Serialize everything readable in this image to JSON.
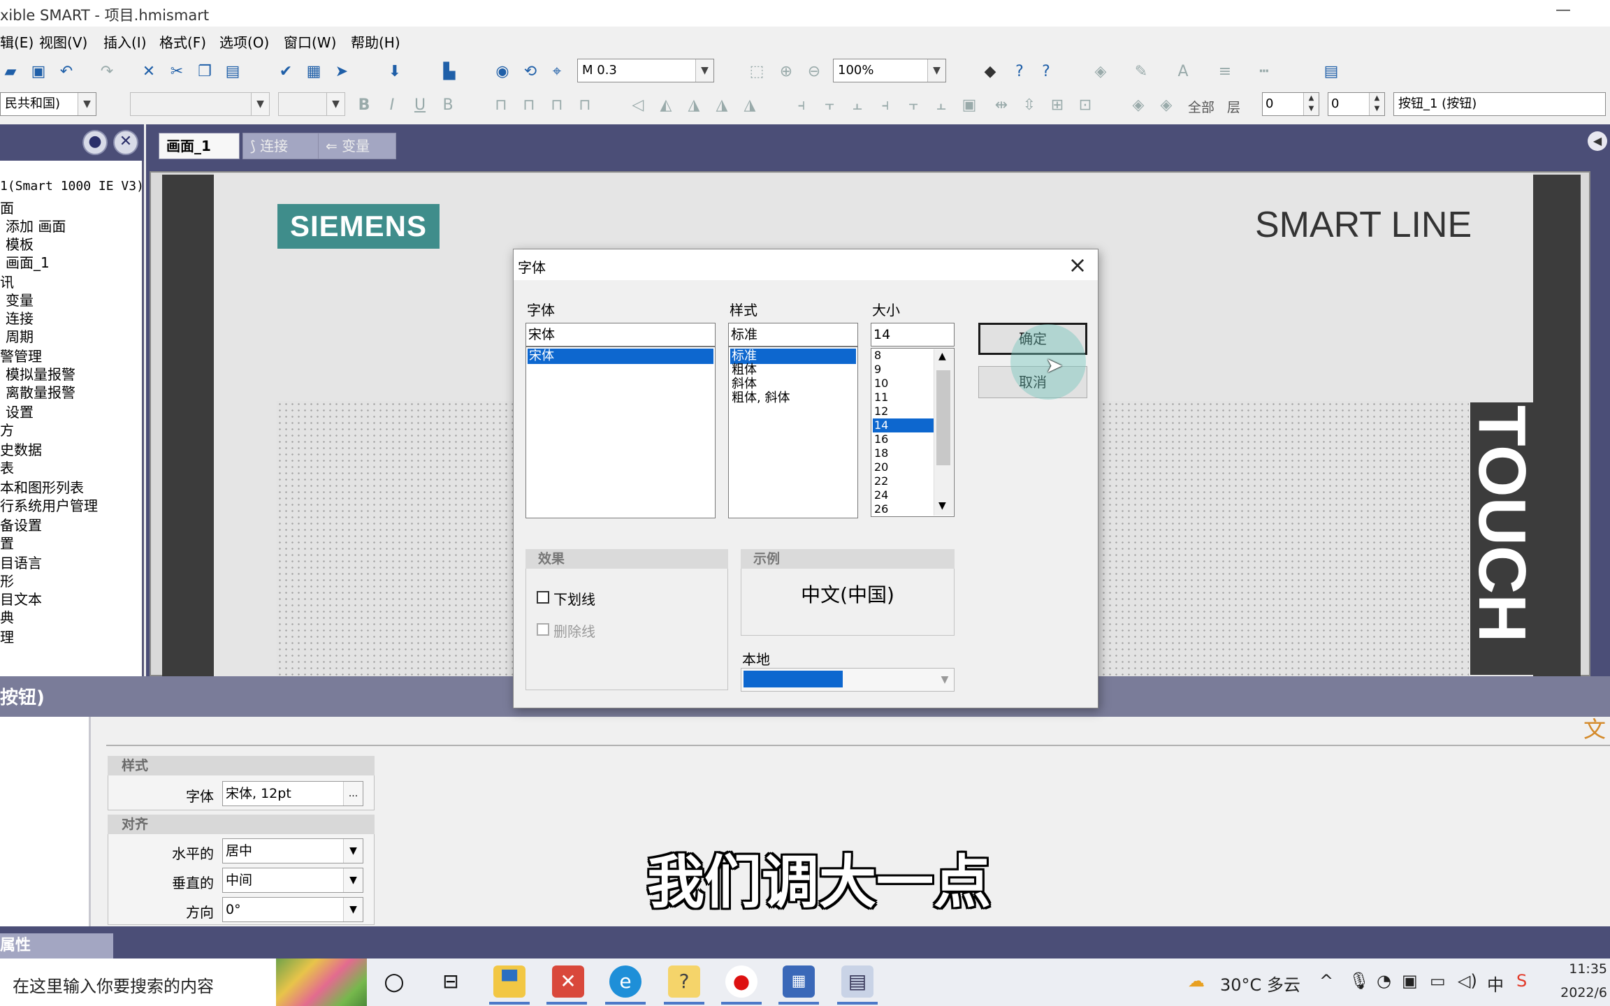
{
  "window": {
    "title": "xible SMART - 项目.hmismart",
    "minimize_glyph": "—"
  },
  "menu": [
    "辑(E)",
    "视图(V)",
    "插入(I)",
    "格式(F)",
    "选项(O)",
    "窗口(W)",
    "帮助(H)"
  ],
  "toolbar1": {
    "address_value": "M 0.3",
    "zoom_value": "100%"
  },
  "toolbar2": {
    "language_value": "民共和国)",
    "all_label": "全部",
    "layer_label": "层",
    "x_value": "0",
    "y_value": "0",
    "object_value": "按钮_1 (按钮)"
  },
  "tree": {
    "items": [
      "1(Smart 1000 IE V3)",
      "面",
      "添加 画面",
      "模板",
      "画面_1",
      "讯",
      "变量",
      "连接",
      "周期",
      "警管理",
      "模拟量报警",
      "离散量报警",
      "设置",
      "方",
      "史数据",
      "表",
      "本和图形列表",
      "行系统用户管理",
      "备设置",
      "置",
      "目语言",
      "形",
      "目文本",
      "典",
      "理"
    ]
  },
  "tabs": [
    {
      "label": "画面_1",
      "active": true
    },
    {
      "label": "连接",
      "active": false
    },
    {
      "label": "变量",
      "active": false
    }
  ],
  "hmi": {
    "logo": "SIEMENS",
    "brand_line": "SMART LINE",
    "side_text": "TOUCH"
  },
  "properties": {
    "header": "按钮)",
    "bottom_tab": "属性",
    "style_group": "样式",
    "font_label": "字体",
    "font_value": "宋体, 12pt",
    "font_btn": "...",
    "align_group": "对齐",
    "horizontal_label": "水平的",
    "horizontal_value": "居中",
    "vertical_label": "垂直的",
    "vertical_value": "中间",
    "direction_label": "方向",
    "direction_value": "0°"
  },
  "dialog": {
    "title": "字体",
    "font_label": "字体",
    "font_value": "宋体",
    "font_list": [
      "宋体"
    ],
    "style_label": "样式",
    "style_value": "标准",
    "style_list": [
      "标准",
      "粗体",
      "斜体",
      "粗体, 斜体"
    ],
    "size_label": "大小",
    "size_value": "14",
    "size_list": [
      "8",
      "9",
      "10",
      "11",
      "12",
      "14",
      "16",
      "18",
      "20",
      "22",
      "24",
      "26"
    ],
    "ok": "确定",
    "cancel": "取消",
    "effects_label": "效果",
    "underline_label": "下划线",
    "strike_label": "删除线",
    "sample_label": "示例",
    "sample_text": "中文(中国)",
    "locale_label": "本地"
  },
  "subtitle": "我们调大一点",
  "taskbar": {
    "search_placeholder": "在这里输入你要搜索的内容",
    "weather": "30°C 多云",
    "ime": "中",
    "time": "11:35",
    "date": "2022/6"
  }
}
